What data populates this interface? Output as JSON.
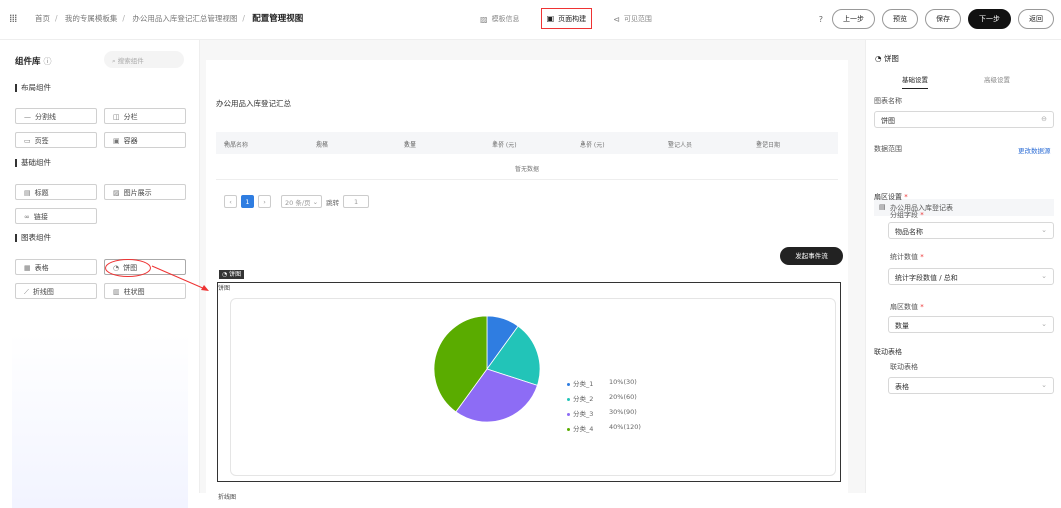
{
  "topbar": {
    "breadcrumb": [
      "首页",
      "我的专属模板集",
      "办公用品入库登记汇总管理视图"
    ],
    "current": "配置管理视图",
    "steps": [
      "模板信息",
      "页面构建",
      "可见范围"
    ],
    "actions": [
      "上一步",
      "预览",
      "保存",
      "下一步",
      "返回"
    ]
  },
  "left": {
    "title": "组件库",
    "search_placeholder": "搜索组件",
    "sections": [
      "布局组件",
      "基础组件",
      "图表组件"
    ],
    "layout_items": [
      "分割线",
      "分栏",
      "页签",
      "容器"
    ],
    "basic_items": [
      "标题",
      "图片展示",
      "链接"
    ],
    "chart_items": [
      "表格",
      "饼图",
      "折线图",
      "柱状图"
    ]
  },
  "canvas": {
    "table_title": "办公用品入库登记汇总",
    "columns": [
      "物品名称",
      "规格",
      "数量",
      "单价 (元)",
      "总价 (元)",
      "登记人员",
      "登记日期"
    ],
    "no_data": "暂无数据",
    "pager": {
      "page": "1",
      "page_size": "20 条/页",
      "jump_label": "跳转",
      "jump_value": "1"
    },
    "flow_button": "发起事件流",
    "pie_tag": "饼图",
    "pie_label": "饼图",
    "line_label": "折线图"
  },
  "chart_data": {
    "type": "pie",
    "categories": [
      "分类_1",
      "分类_2",
      "分类_3",
      "分类_4"
    ],
    "values": [
      30,
      60,
      90,
      120
    ],
    "percent_labels": [
      "10%(30)",
      "20%(60)",
      "30%(90)",
      "40%(120)"
    ],
    "colors": [
      "#2f7de1",
      "#22c4b8",
      "#8d6cf5",
      "#5aac00"
    ],
    "legend_position": "right"
  },
  "right": {
    "header": "饼图",
    "tabs": [
      "基础设置",
      "高级设置"
    ],
    "chart_name_label": "图表名称",
    "chart_name_value": "饼图",
    "data_range_label": "数据范围",
    "change_source": "更改数据源",
    "data_source": "办公用品入库登记表",
    "sector_settings": "扇区设置",
    "group_field_label": "分组字段",
    "group_field_value": "物品名称",
    "stat_value_label": "统计数值",
    "stat_value_value": "统计字段数值 / 总和",
    "sector_value_label": "扇区数值",
    "sector_value_value": "数量",
    "linkage_title": "联动表格",
    "linkage_label": "联动表格",
    "linkage_value": "表格"
  }
}
